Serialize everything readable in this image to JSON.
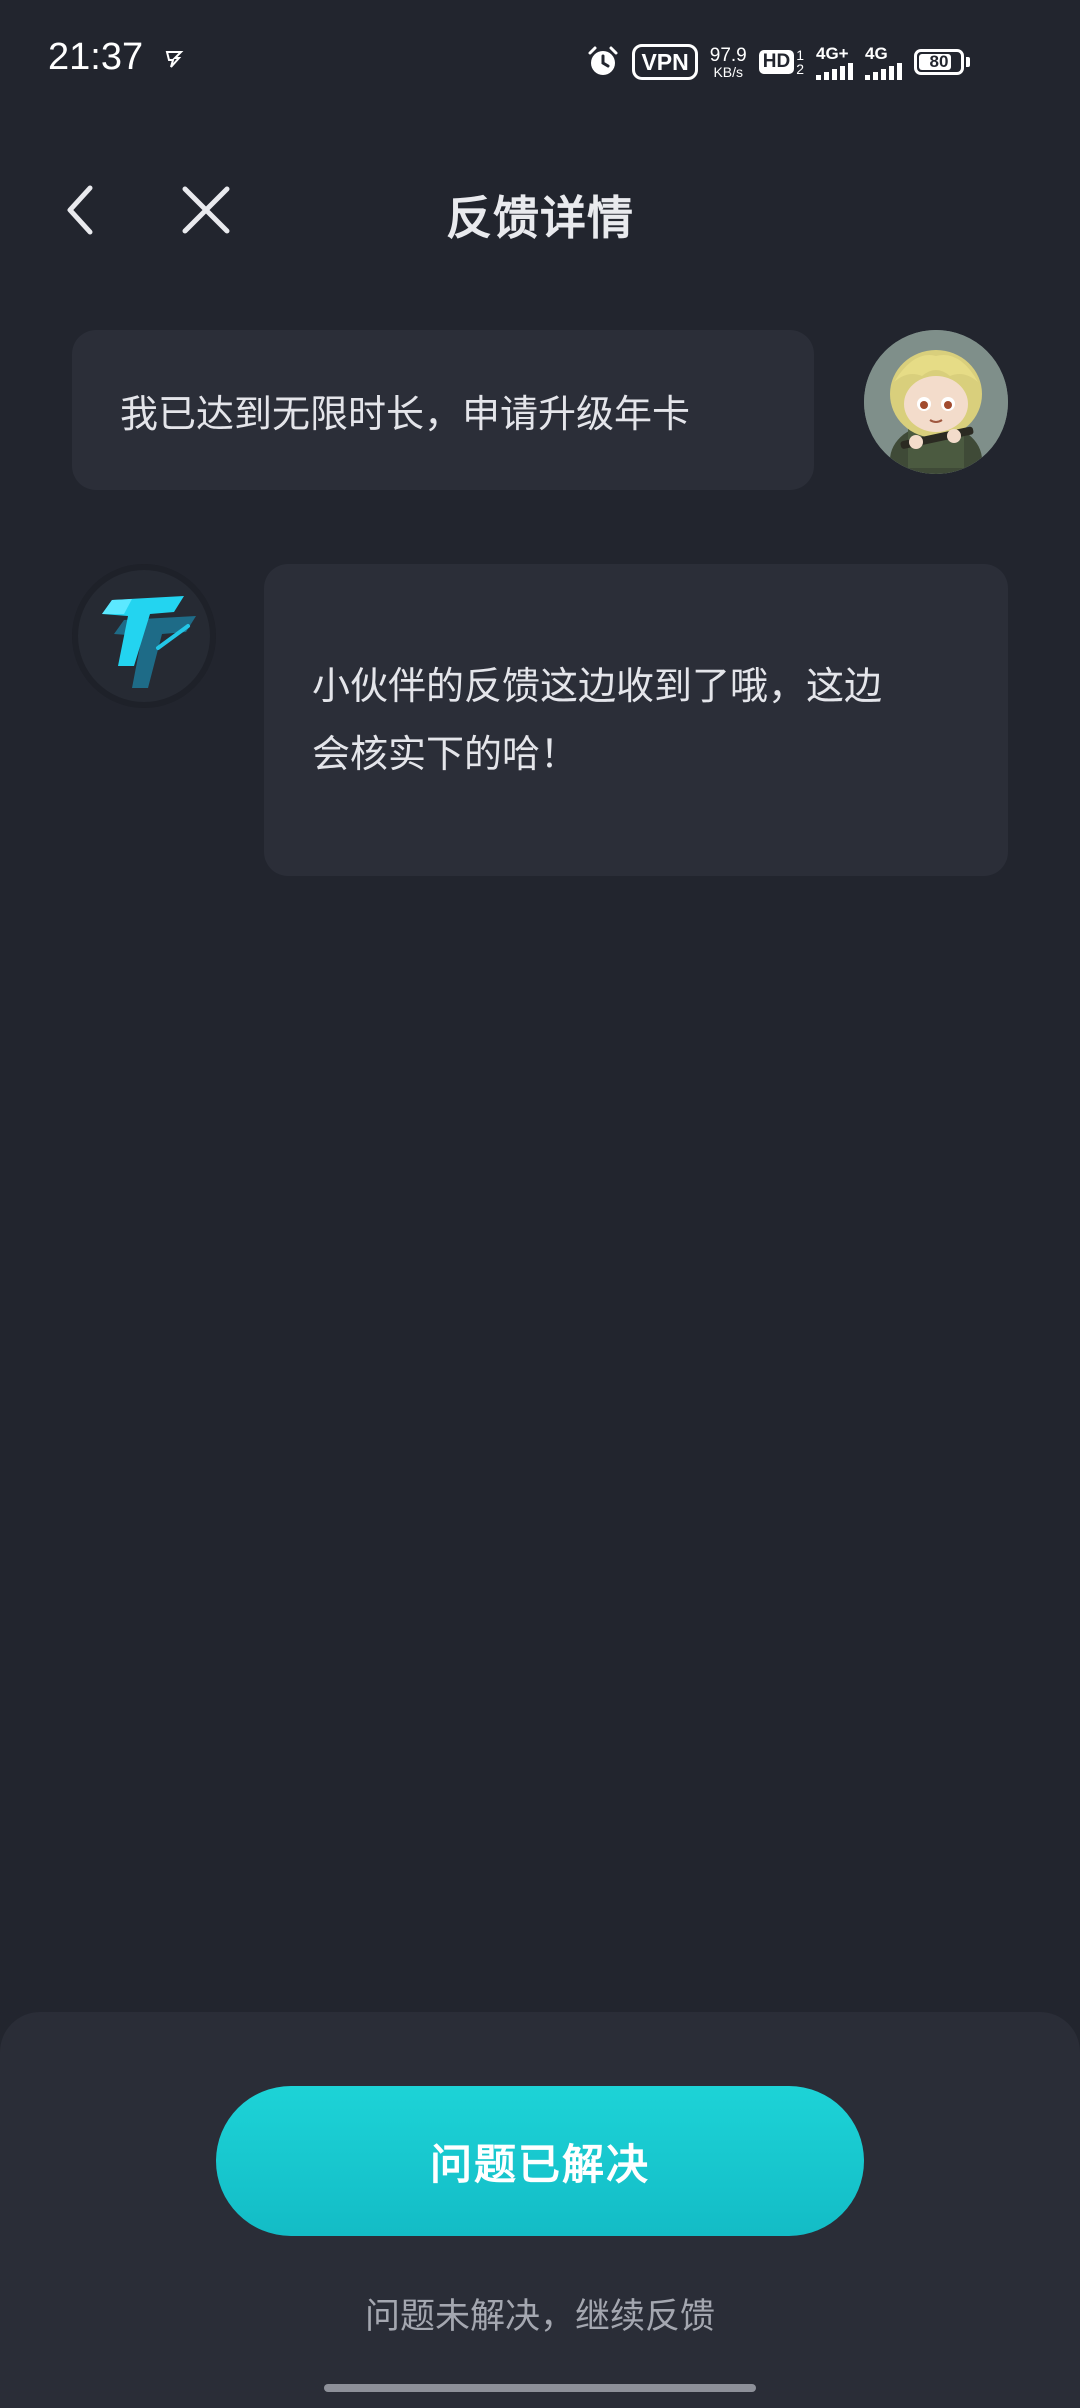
{
  "status_bar": {
    "time": "21:37",
    "vpn": "VPN",
    "net_speed_value": "97.9",
    "net_speed_unit": "KB/s",
    "hd": "HD",
    "hd_sim_1": "1",
    "hd_sim_2": "2",
    "signal_1_label": "4G+",
    "signal_2_label": "4G",
    "battery": "80",
    "battery_level_percent": 80,
    "icons": [
      "app-notification-icon",
      "alarm-icon",
      "vpn-icon",
      "hd-icon",
      "signal-icon",
      "battery-icon"
    ]
  },
  "header": {
    "title": "反馈详情",
    "back_icon": "chevron-left-icon",
    "close_icon": "close-icon"
  },
  "conversation": {
    "user_message": "我已达到无限时长，申请升级年卡",
    "bot_message_line_1": "小伙伴的反馈这边收到了哦，这边",
    "bot_message_line_2": "会核实下的哈！"
  },
  "bottom_sheet": {
    "resolved_button": "问题已解决",
    "unresolved_link": "问题未解决，继续反馈"
  },
  "colors": {
    "background": "#22252e",
    "bubble": "#2b2e38",
    "sheet": "#2a2d37",
    "accent": "#1dc9d0",
    "text_primary": "#e4e5ea",
    "text_secondary": "#a4a7b0"
  }
}
